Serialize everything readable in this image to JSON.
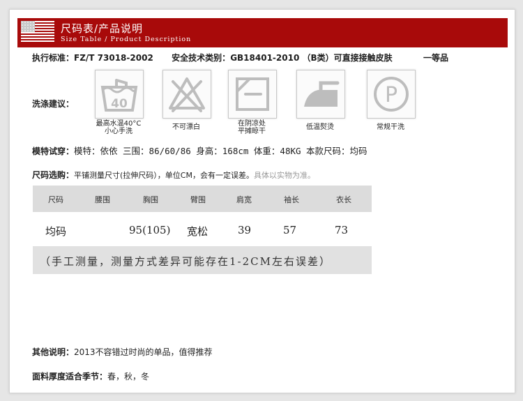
{
  "header": {
    "title": "尺码表/产品说明",
    "subtitle": "Size Table / Product Description"
  },
  "standard": {
    "exec_label": "执行标准：",
    "exec_value": "FZ/T 73018-2002",
    "safety_label": "安全技术类别：",
    "safety_value": "GB18401-2010 （B类）可直接接触皮肤",
    "grade": "一等品"
  },
  "wash": {
    "label": "洗涤建议：",
    "items": [
      {
        "icon": "wash-40-icon",
        "caption_1": "最高水温40°C",
        "caption_2": "小心手洗",
        "num": "40"
      },
      {
        "icon": "no-bleach-icon",
        "caption_1": "不可漂白",
        "caption_2": ""
      },
      {
        "icon": "dry-flat-shade-icon",
        "caption_1": "在阴凉处",
        "caption_2": "平摊晾干"
      },
      {
        "icon": "iron-low-icon",
        "caption_1": "低温熨烫",
        "caption_2": ""
      },
      {
        "icon": "dry-clean-icon",
        "caption_1": "常规干洗",
        "caption_2": "",
        "letter": "P"
      }
    ]
  },
  "model": {
    "label": "模特试穿：",
    "text": "模特：依依  三围：86/60/86 身高：168cm 体重：48KG 本款尺码：均码"
  },
  "size_select": {
    "label": "尺码选购：",
    "text": "平铺测量尺寸(拉伸尺码），单位CM，会有一定误差。",
    "grey": "具体以实物为准。"
  },
  "table": {
    "headers": [
      "尺码",
      "腰围",
      "胸围",
      "臂围",
      "肩宽",
      "袖长",
      "衣长"
    ],
    "row": [
      "均码",
      "",
      "95(105)",
      "宽松",
      "39",
      "57",
      "73"
    ]
  },
  "note": "（手工测量，测量方式差异可能存在1-2CM左右误差）",
  "other": {
    "label": "其他说明：",
    "text": "2013不容错过时尚的单品，值得推荐"
  },
  "fabric": {
    "label": "面料厚度适合季节：",
    "text": "春，秋，冬"
  },
  "colors": {
    "header_bg": "#a80a0a",
    "table_header_bg": "#dcdcdc",
    "icon_stroke": "#bdbdbd"
  }
}
